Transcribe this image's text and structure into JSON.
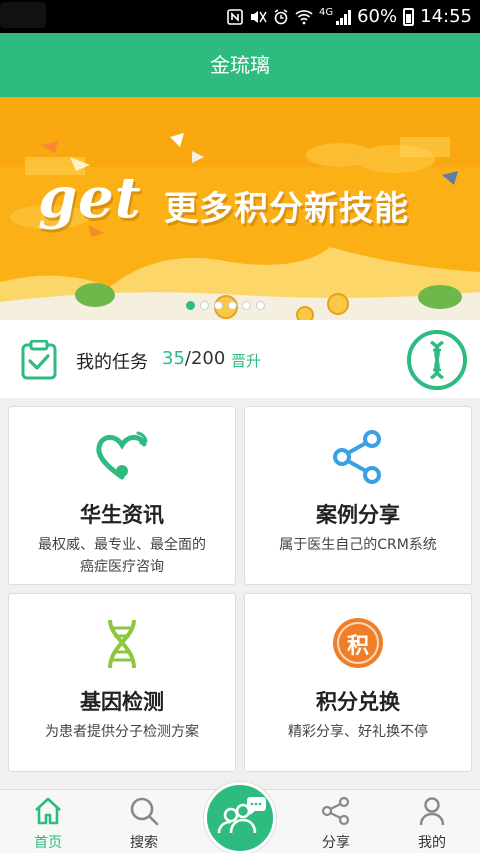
{
  "status_bar": {
    "network": "4G",
    "battery": "60%",
    "time": "14:55",
    "icons": [
      "nfc-icon",
      "mute-icon",
      "alarm-icon",
      "wifi-icon",
      "signal-icon",
      "battery-icon"
    ]
  },
  "header": {
    "title": "金琉璃"
  },
  "banner": {
    "get_text": "get",
    "headline": "更多积分新技能",
    "slide_count": 6,
    "active_slide": 1
  },
  "task": {
    "label": "我的任务",
    "current": "35",
    "separator": "/",
    "total": "200",
    "action": "晋升"
  },
  "cards": [
    {
      "title": "华生资讯",
      "desc1": "最权威、最专业、最全面的",
      "desc2": "癌症医疗咨询",
      "icon": "heart-signal-icon"
    },
    {
      "title": "案例分享",
      "desc1": "属于医生自己的CRM系统",
      "desc2": "",
      "icon": "share-icon"
    },
    {
      "title": "基因检测",
      "desc1": "为患者提供分子检测方案",
      "desc2": "",
      "icon": "dna-icon"
    },
    {
      "title": "积分兑换",
      "desc1": "精彩分享、好礼换不停",
      "desc2": "",
      "icon": "points-icon",
      "badge": "积"
    }
  ],
  "bottom_nav": {
    "home": "首页",
    "search": "搜索",
    "share": "分享",
    "mine": "我的",
    "active": "home"
  },
  "colors": {
    "primary": "#2dbb7f",
    "banner_bg": "#fbb016",
    "points_orange": "#f07d27",
    "dna_lime": "#8dc63f",
    "share_blue": "#39a0e4"
  }
}
